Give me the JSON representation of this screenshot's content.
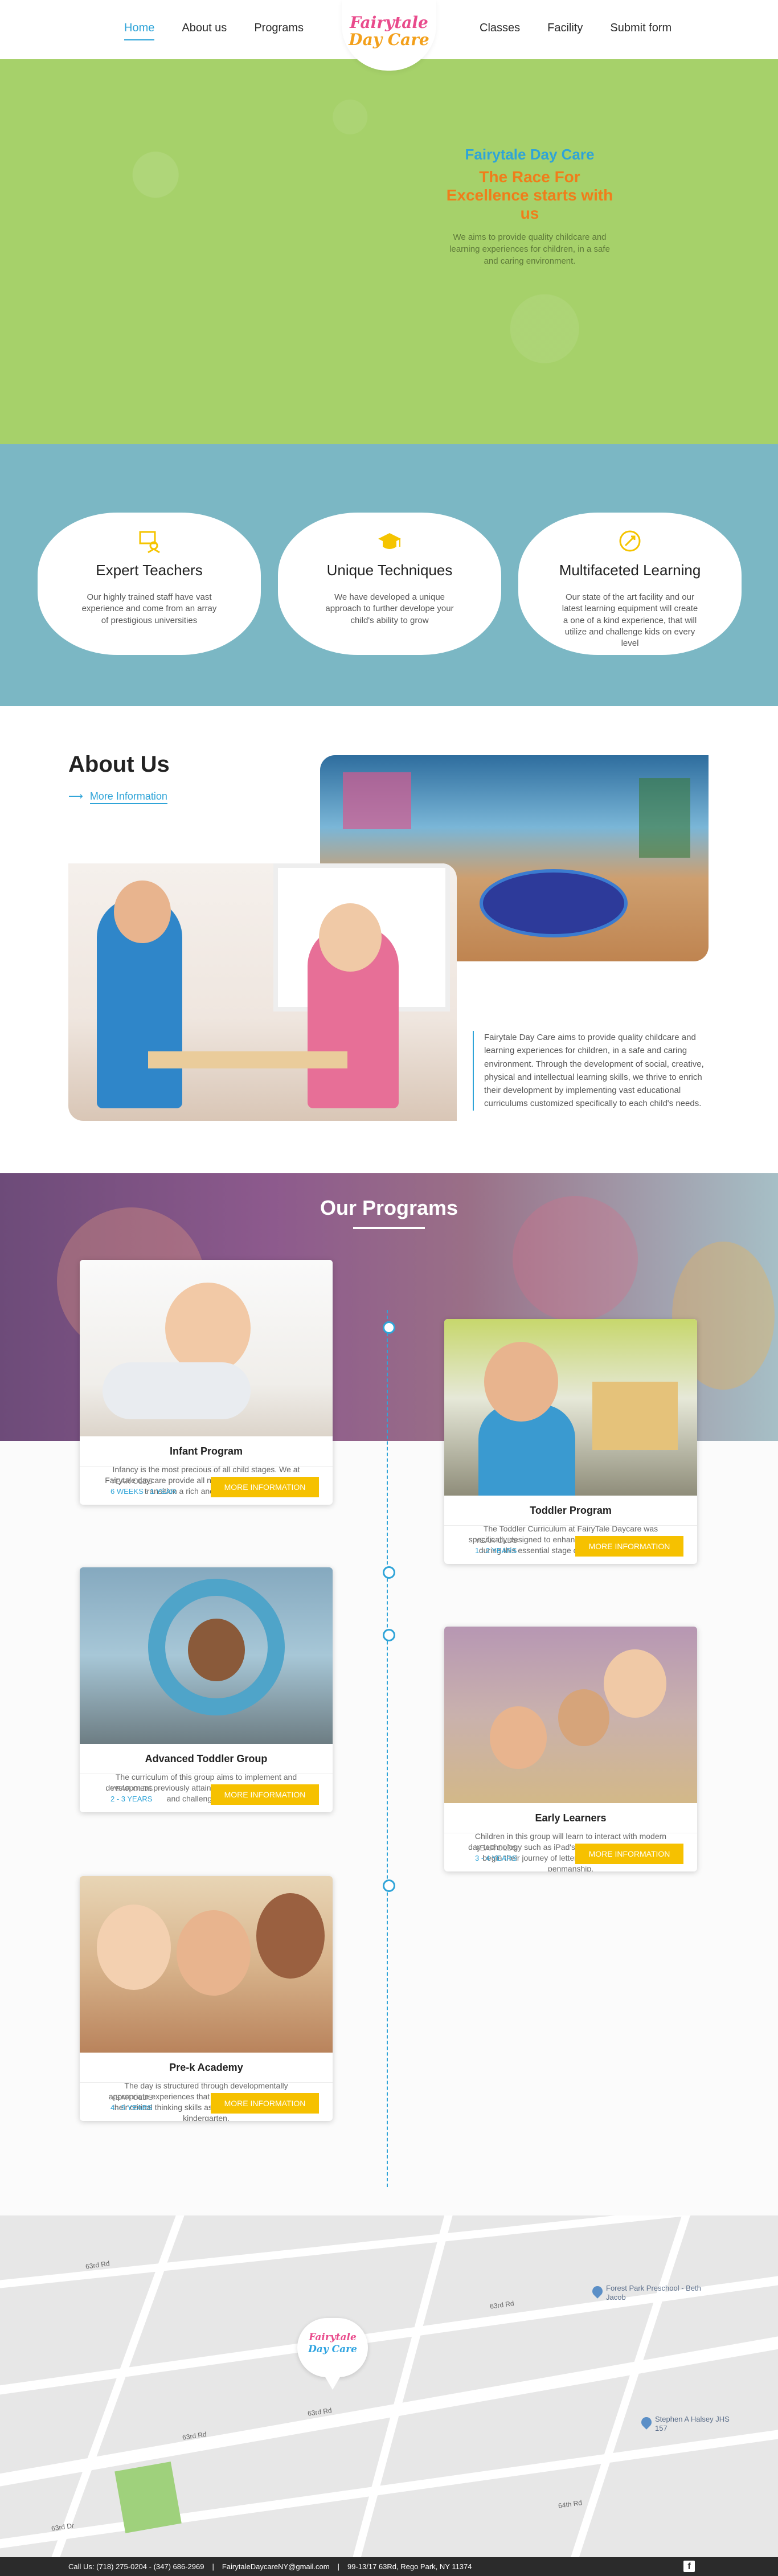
{
  "header": {
    "nav_left": [
      "Home",
      "About us",
      "Programs"
    ],
    "nav_right": [
      "Classes",
      "Facility",
      "Submit form"
    ],
    "logo_line1": "Fairytale",
    "logo_line2": "Day Care"
  },
  "hero": {
    "brand": "Fairytale Day Care",
    "headline": "The Race For Excellence starts with us",
    "description": "We aims to provide quality childcare and learning experiences for children, in a safe and caring environment."
  },
  "features": [
    {
      "icon": "teacher-icon",
      "title": "Expert Teachers",
      "description": "Our highly trained staff have vast experience and come from an array of prestigious universities"
    },
    {
      "icon": "graduation-cap-icon",
      "title": "Unique Techniques",
      "description": "We have developed a unique approach to further develope your child's ability to grow"
    },
    {
      "icon": "rocket-icon",
      "title": "Multifaceted Learning",
      "description": "Our state of the art facility and our latest learning equipment will create a one of a kind experience, that will utilize and challenge kids on every level"
    }
  ],
  "about": {
    "title": "About Us",
    "link_label": "More Information",
    "description": "Fairytale Day Care aims to provide quality childcare and learning experiences for children, in a safe and caring environment. Through the development of social, creative, physical and intellectual learning skills, we thrive to enrich their development by implementing vast educational curriculums customized specifically to each child's needs."
  },
  "programs": {
    "title": "Our Programs",
    "year_label": "YEAR OLDS",
    "button_label": "MORE INFORMATION",
    "items": [
      {
        "title": "Infant Program",
        "description": "Infancy is the most precious of all child stages. We at Fairytale daycare provide all necessary tools to make this transition a rich and seamless one.",
        "ages": "6 WEEKS - 1 YEAR"
      },
      {
        "title": "Toddler Program",
        "description": "The Toddler Curriculum at FairyTale Daycare was specifically designed to enhance the education of toddlers during this essential stage of developmental growth.",
        "ages": "1 - 2 YEARS"
      },
      {
        "title": "Advanced Toddler Group",
        "description": "The curriculum of this group aims to implement and development previously attained skills and introduce new and challenging tasks.",
        "ages": "2 - 3 YEARS"
      },
      {
        "title": "Early Learners",
        "description": "Children in this group will learn to interact with modern day technology such as iPad's™ and Smart Boards™ and begin their journey of letter recognition and proper penmanship.",
        "ages": "3 - 4 YEARS"
      },
      {
        "title": "Pre-k Academy",
        "description": "The day is structured through developmentally appropriate experiences that encourage children to use their critical thinking skills as well as prepare them for kindergarten.",
        "ages": "4 - 5 YEARS"
      }
    ]
  },
  "map": {
    "logo_line1": "Fairytale",
    "logo_line2": "Day Care",
    "poi_1": "Forest Park Preschool - Beth Jacob",
    "poi_2": "Stephen A Halsey JHS 157",
    "streets": [
      "63rd Rd",
      "63rd Rd",
      "63rd Rd",
      "63rd Rd",
      "64th Rd",
      "63rd Dr"
    ]
  },
  "footer": {
    "phone": "Call Us: (718) 275-0204 - (347) 686-2969",
    "email": "FairytaleDaycareNY@gmail.com",
    "address": "99-13/17 63Rd, Rego Park, NY 11374",
    "separator": "|"
  },
  "colors": {
    "hero_bg": "#a6d16a",
    "features_bg": "#7bb7c4",
    "accent_blue": "#2fa4d8",
    "accent_orange": "#f07d1a",
    "button_yellow": "#f6c100"
  }
}
